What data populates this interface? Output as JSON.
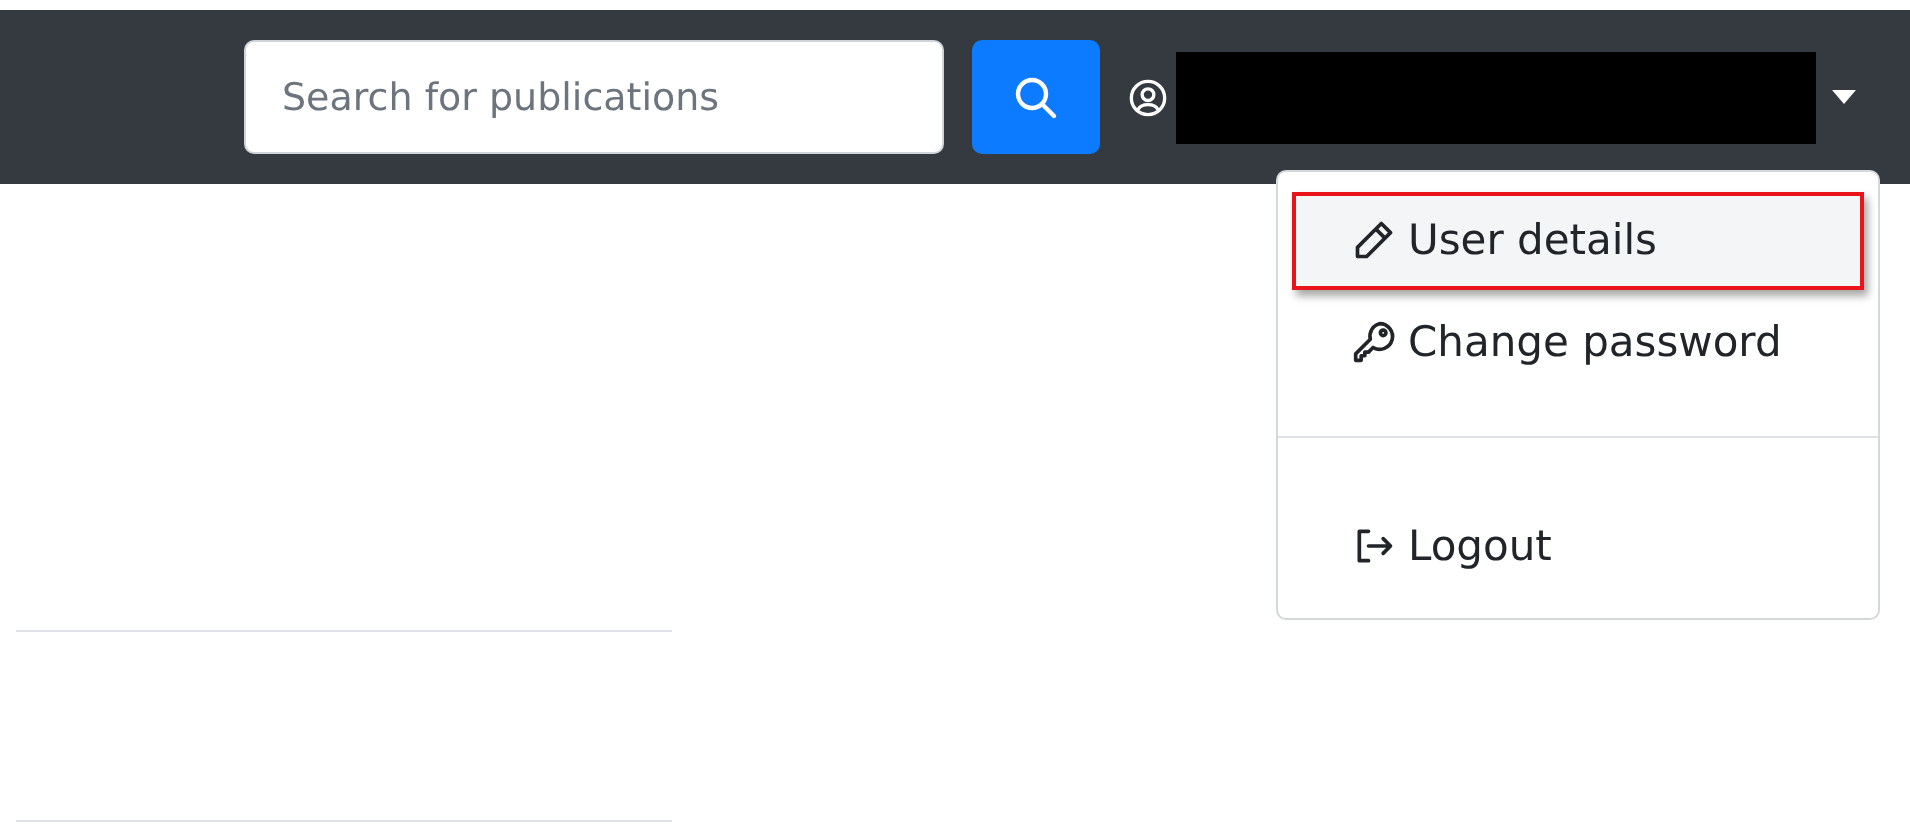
{
  "navbar": {
    "search": {
      "placeholder": "Search for publications"
    }
  },
  "user_menu": {
    "items": [
      {
        "kind": "edit",
        "label": "User details",
        "selected": true
      },
      {
        "kind": "password",
        "label": "Change password",
        "selected": false
      },
      {
        "kind": "divider"
      },
      {
        "kind": "logout",
        "label": "Logout",
        "selected": false
      }
    ]
  }
}
